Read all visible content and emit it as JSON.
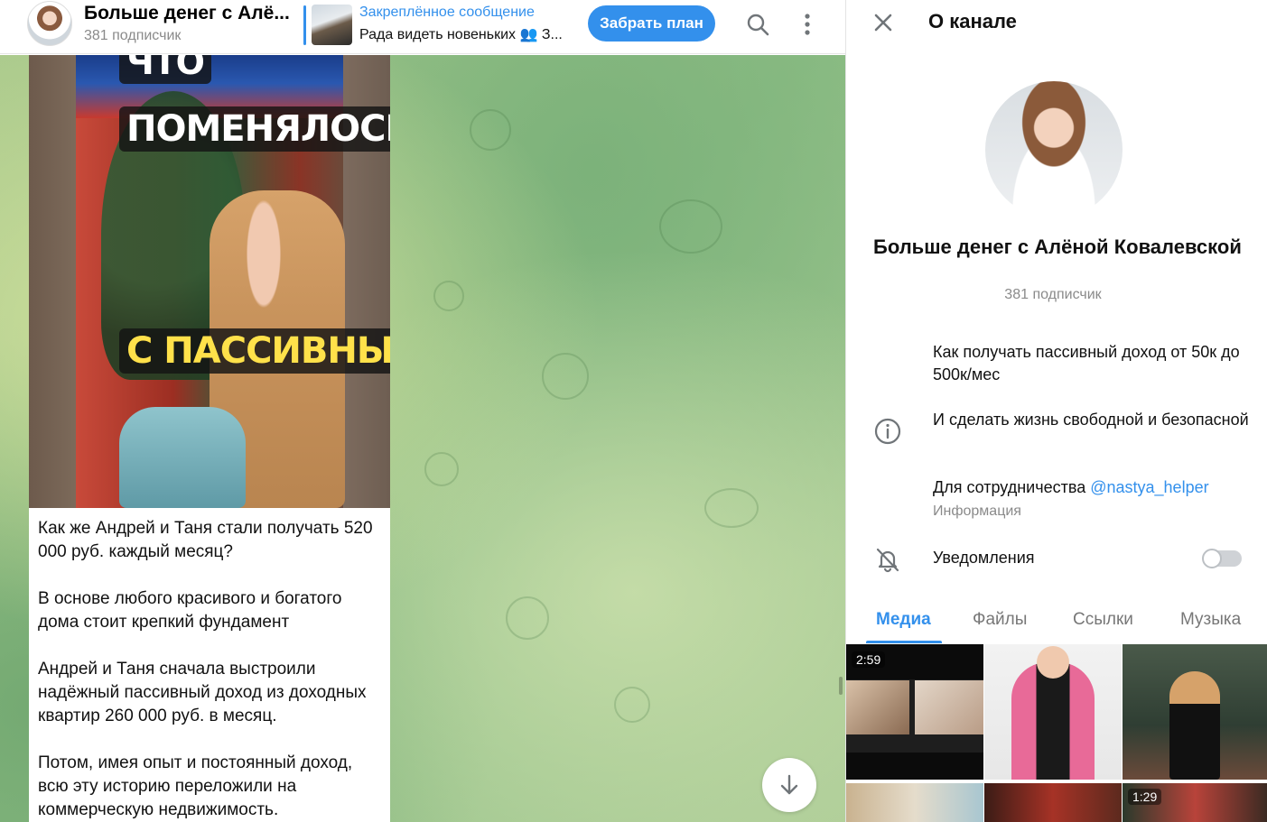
{
  "header": {
    "title": "Больше денег с Алё...",
    "subscribers": "381 подписчик",
    "pinned_label": "Закреплённое сообщение",
    "pinned_text": "Рада видеть новеньких 👥 З...",
    "plan_button": "Забрать план",
    "icons": [
      "search-icon",
      "more-vertical-icon"
    ]
  },
  "chat": {
    "captions": [
      "ЧТО",
      "ПОМЕНЯЛОСЬ",
      "С ПАССИВНЫМ"
    ],
    "paragraphs": [
      "Как же Андрей и Таня стали получать 520 000 руб. каждый месяц?",
      "В основе любого красивого и богатого дома стоит крепкий фундамент",
      "Андрей и Таня сначала выстроили надёжный пассивный доход из доходных квартир 260 000 руб. в месяц.",
      "Потом, имея опыт и постоянный доход, всю эту историю переложили на коммерческую недвижимость."
    ]
  },
  "panel": {
    "title": "О канале",
    "name": "Больше денег с Алёной Ковалевской",
    "subscribers": "381 подписчик",
    "description": [
      "Как получать пассивный доход от 50к до 500к/мес",
      "И сделать жизнь свободной и безопасной"
    ],
    "cooperation_text": "Для сотрудничества",
    "cooperation_link": "@nastya_helper",
    "info_label": "Информация",
    "notifications_label": "Уведомления",
    "notifications_on": false,
    "tabs": [
      "Медиа",
      "Файлы",
      "Ссылки",
      "Музыка"
    ],
    "active_tab": "Медиа",
    "media_badges": [
      "2:59",
      "1:29"
    ]
  },
  "colors": {
    "accent": "#3390ec",
    "caption_highlight": "#ffe14a"
  }
}
